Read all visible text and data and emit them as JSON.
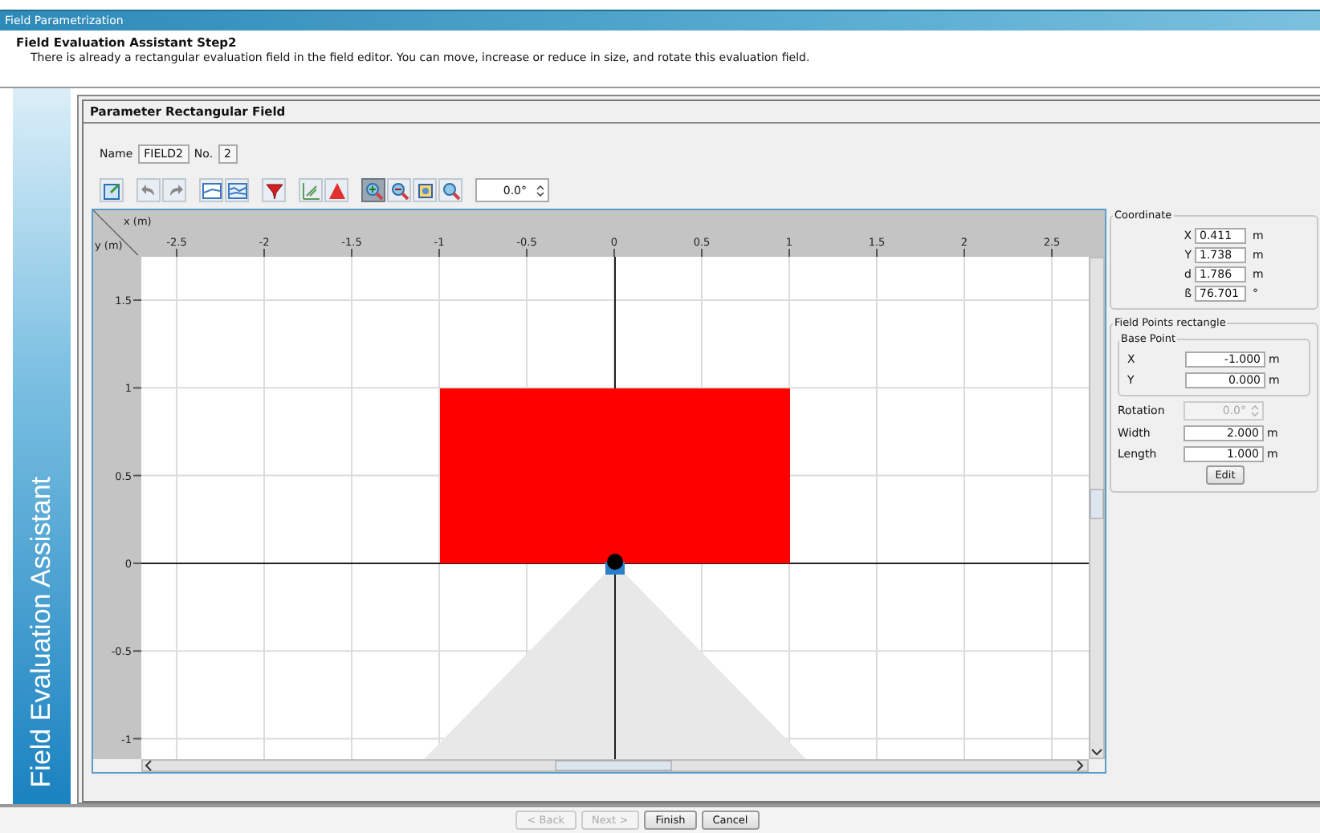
{
  "window": {
    "title": "Field Parametrization"
  },
  "header": {
    "title": "Field Evaluation Assistant Step2",
    "description": "There is already a rectangular evaluation field in the field editor. You can move, increase or reduce in size, and rotate this evaluation field."
  },
  "sidebar": {
    "title": "Field Evaluation Assistant"
  },
  "panel": {
    "title": "Parameter Rectangular Field",
    "name_label": "Name",
    "name_value": "FIELD2",
    "number_label": "No.",
    "number_value": "2"
  },
  "toolbar": {
    "tools": [
      {
        "kind": "edit",
        "selected": false
      },
      {
        "kind": "undo",
        "selected": false
      },
      {
        "kind": "redo",
        "selected": false
      },
      {
        "kind": "chart",
        "selected": false
      },
      {
        "kind": "chart2",
        "selected": false
      },
      {
        "kind": "funnel",
        "selected": false
      },
      {
        "kind": "grid",
        "selected": false
      },
      {
        "kind": "triangle",
        "selected": false
      },
      {
        "kind": "zoom-in",
        "selected": true
      },
      {
        "kind": "zoom-out",
        "selected": false
      },
      {
        "kind": "fit",
        "selected": false
      },
      {
        "kind": "zoom",
        "selected": false
      }
    ],
    "rotation": "0.0°"
  },
  "editor": {
    "x_axis_label": "x (m)",
    "y_axis_label": "y (m)",
    "x_ticks": [
      "-2.5",
      "-2",
      "-1.5",
      "-1",
      "-0.5",
      "0",
      "0.5",
      "1",
      "1.5",
      "2",
      "2.5"
    ],
    "y_ticks": [
      "1.5",
      "1",
      "0.5",
      "0",
      "-0.5",
      "-1"
    ]
  },
  "coordinate": {
    "title": "Coordinate",
    "rows": [
      {
        "label": "X",
        "value": "0.411",
        "unit": "m"
      },
      {
        "label": "Y",
        "value": "1.738",
        "unit": "m"
      },
      {
        "label": "d",
        "value": "1.786",
        "unit": "m"
      },
      {
        "label": "ß",
        "value": "76.701",
        "unit": "°"
      }
    ]
  },
  "field_points": {
    "title": "Field Points rectangle",
    "base_point": {
      "title": "Base Point",
      "rows": [
        {
          "label": "X",
          "value": "-1.000",
          "unit": "m"
        },
        {
          "label": "Y",
          "value": "0.000",
          "unit": "m"
        }
      ]
    },
    "rows": [
      {
        "kind": "spinner",
        "label": "Rotation",
        "value": "0.0°",
        "disabled": true
      },
      {
        "kind": "text",
        "label": "Width",
        "value": "2.000",
        "unit": "m",
        "disabled": false
      },
      {
        "kind": "text",
        "label": "Length",
        "value": "1.000",
        "unit": "m",
        "disabled": false
      }
    ],
    "edit_button": "Edit"
  },
  "buttons": [
    {
      "label": "< Back",
      "disabled": true
    },
    {
      "label": "Next >",
      "disabled": true
    },
    {
      "label": "Finish",
      "disabled": false
    },
    {
      "label": "Cancel",
      "disabled": false
    }
  ]
}
